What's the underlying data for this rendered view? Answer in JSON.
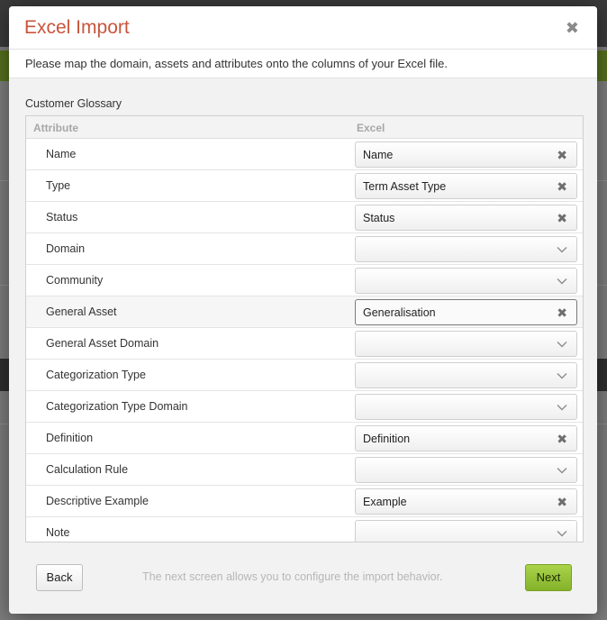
{
  "dialog": {
    "title": "Excel Import",
    "close_glyph": "✖",
    "info_text": "Please map the domain, assets and attributes onto the columns of your Excel file.",
    "group_label": "Customer Glossary",
    "columns": {
      "attribute": "Attribute",
      "excel": "Excel"
    },
    "rows": [
      {
        "label": "Name",
        "value": "Name",
        "control": "clear"
      },
      {
        "label": "Type",
        "value": "Term Asset Type",
        "control": "clear"
      },
      {
        "label": "Status",
        "value": "Status",
        "control": "clear"
      },
      {
        "label": "Domain",
        "value": "",
        "control": "dropdown"
      },
      {
        "label": "Community",
        "value": "",
        "control": "dropdown"
      },
      {
        "label": "General Asset",
        "value": "Generalisation",
        "control": "clear",
        "focused": true
      },
      {
        "label": "General Asset Domain",
        "value": "",
        "control": "dropdown"
      },
      {
        "label": "Categorization Type",
        "value": "",
        "control": "dropdown"
      },
      {
        "label": "Categorization Type Domain",
        "value": "",
        "control": "dropdown"
      },
      {
        "label": "Definition",
        "value": "Definition",
        "control": "clear"
      },
      {
        "label": "Calculation Rule",
        "value": "",
        "control": "dropdown"
      },
      {
        "label": "Descriptive Example",
        "value": "Example",
        "control": "clear"
      },
      {
        "label": "Note",
        "value": "",
        "control": "dropdown"
      }
    ],
    "footer": {
      "back_label": "Back",
      "hint": "The next screen allows you to configure the import behavior.",
      "next_label": "Next"
    }
  },
  "colors": {
    "title": "#c8553d",
    "next_button": "#92c13a"
  },
  "icons": {
    "clear": "clear-icon",
    "dropdown": "chevron-down-icon",
    "close": "close-icon"
  }
}
